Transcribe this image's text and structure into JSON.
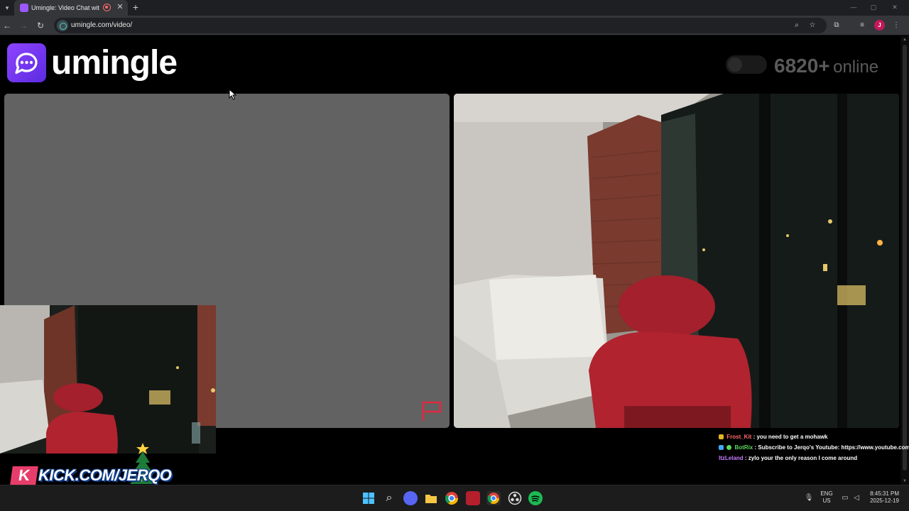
{
  "browser": {
    "tab_title": "Umingle: Video Chat with S",
    "tab_close": "✕",
    "new_tab": "+",
    "url": "umingle.com/video/",
    "profile_initial": "J",
    "icons": [
      "back-arrow-icon",
      "forward-arrow-icon",
      "reload-icon",
      "zoom-icon",
      "bookmark-star-icon",
      "extensions-icon",
      "media-control-icon",
      "kebab-menu-icon"
    ]
  },
  "page": {
    "brand": "umingle",
    "online_count": "6820+",
    "online_label": "online",
    "brand_color": "#7b3ff2",
    "report_flag_color": "#e0293f"
  },
  "chat": {
    "messages": [
      {
        "user": "Frost_Kit",
        "text": ": you need to get a mohawk",
        "color": "#ff6b6b"
      },
      {
        "user": "BotRix",
        "text": ": Subscribe to Jerqo's Youtube: https://www.youtube.com/jerqo",
        "color": "#5cd65c"
      },
      {
        "user": "ItzLeland",
        "text": ": zylo your the only reason I come around",
        "color": "#c77dff"
      }
    ]
  },
  "overlay": {
    "kick_k": "K",
    "kick_text": "KICK.COM/JERQO"
  },
  "taskbar": {
    "lang_top": "ENG",
    "lang_bottom": "US",
    "time": "8:45:31 PM",
    "date": "2025-12-19",
    "apps": [
      "windows-start-icon",
      "search-icon",
      "discord-icon",
      "file-explorer-icon",
      "chrome-icon",
      "voicemeeter-icon",
      "chrome-active-icon",
      "obs-icon",
      "spotify-icon"
    ]
  }
}
